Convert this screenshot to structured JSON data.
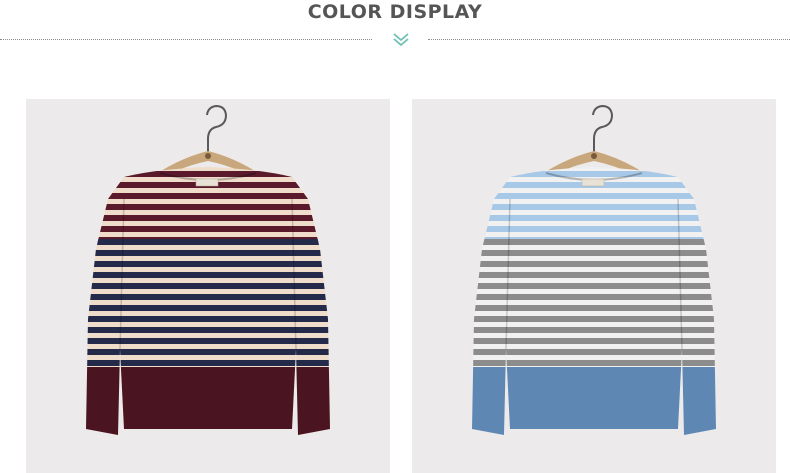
{
  "section": {
    "title": "COLOR DISPLAY",
    "chevron_icon": "chevron-down-double-icon",
    "accent_color": "#6cc1b4"
  },
  "products": [
    {
      "name": "burgundy-navy-striped-sweater",
      "colors": {
        "stripe_a": "#5b1a2b",
        "stripe_b": "#efdccb",
        "stripe_c": "#232a4a",
        "hem": "#4a1420"
      }
    },
    {
      "name": "blue-grey-striped-sweater",
      "colors": {
        "stripe_a": "#a8c8e8",
        "stripe_b": "#f1f1f1",
        "stripe_c": "#8c8c8c",
        "hem": "#5f87b4"
      }
    }
  ]
}
